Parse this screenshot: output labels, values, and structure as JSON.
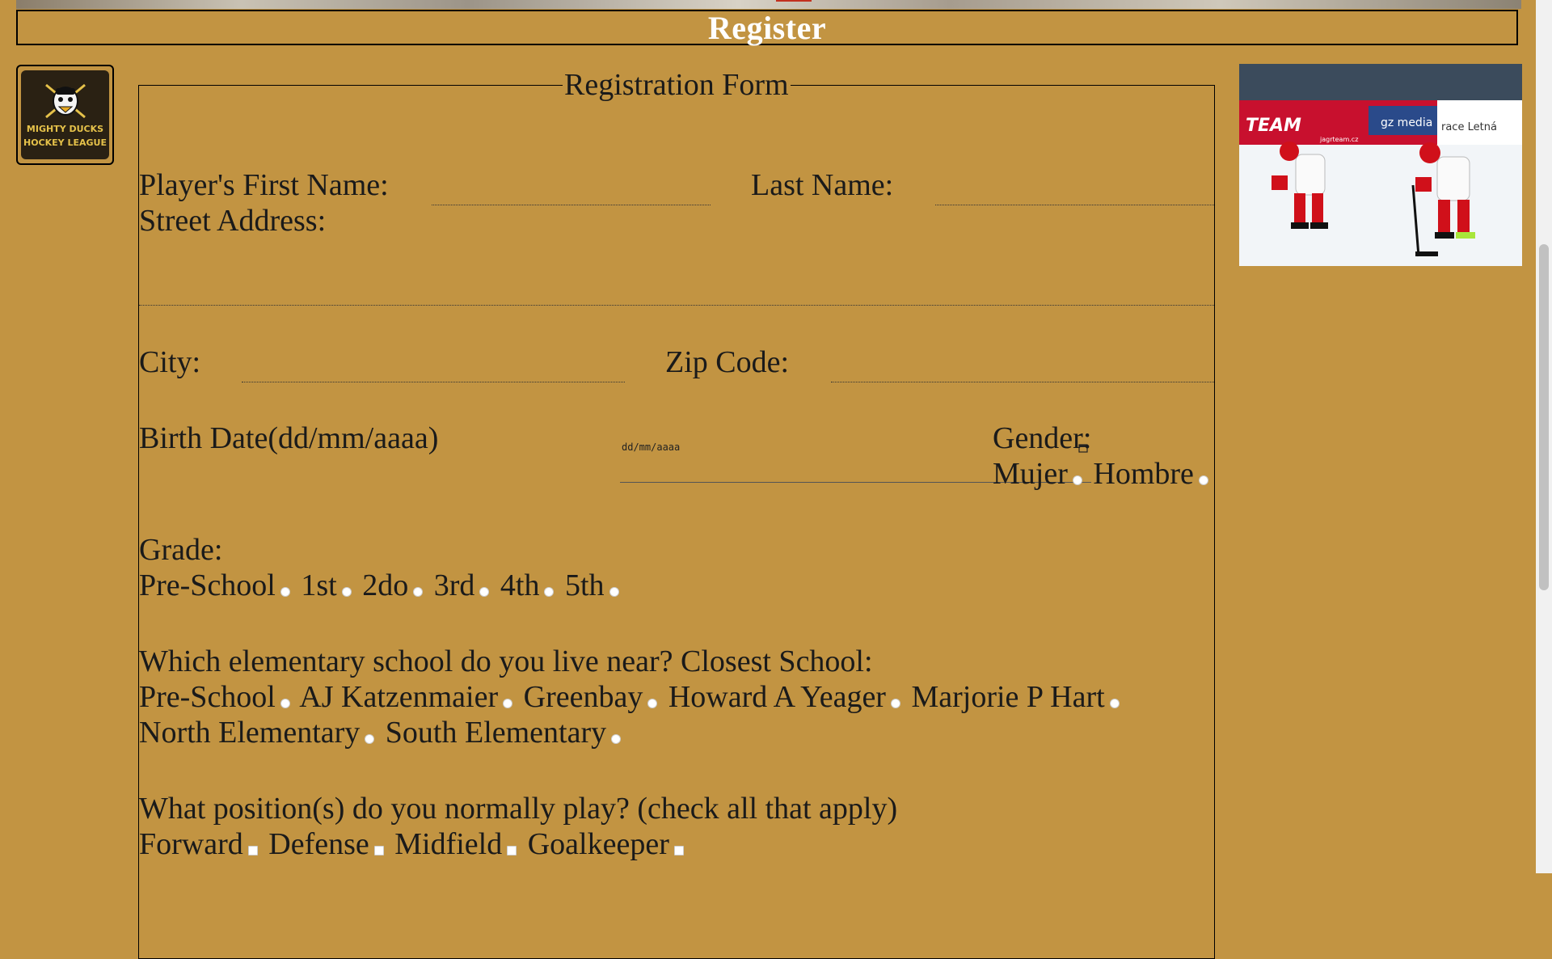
{
  "header": {
    "title": "Register"
  },
  "logo": {
    "line1": "MIGHTY DUCKS",
    "line2": "HOCKEY LEAGUE"
  },
  "photo": {
    "banner1": "TEAM",
    "banner2": "gz media",
    "banner3": "race Letná",
    "banner4": "jagrteam.cz"
  },
  "form": {
    "legend": "Registration Form",
    "first_name_label": "Player's First Name:",
    "last_name_label": "Last Name:",
    "street_label": "Street Address:",
    "city_label": "City:",
    "zip_label": "Zip Code:",
    "birth_label": "Birth Date(dd/mm/aaaa)",
    "birth_placeholder": "dd/mm/aaaa",
    "gender_label": "Gender:",
    "gender_options": [
      "Mujer",
      "Hombre"
    ],
    "grade_label": "Grade:",
    "grade_options": [
      "Pre-School",
      "1st",
      "2do",
      "3rd",
      "4th",
      "5th"
    ],
    "school_question": "Which elementary school do you live near? Closest School:",
    "school_options": [
      "Pre-School",
      "AJ Katzenmaier",
      "Greenbay",
      "Howard A Yeager",
      "Marjorie P Hart",
      "North Elementary",
      "South Elementary"
    ],
    "position_question": "What position(s) do you normally play? (check all that apply)",
    "position_options": [
      "Forward",
      "Defense",
      "Midfield",
      "Goalkeeper"
    ]
  },
  "colors": {
    "background": "#C29442",
    "header_text": "#FFFFFF"
  }
}
